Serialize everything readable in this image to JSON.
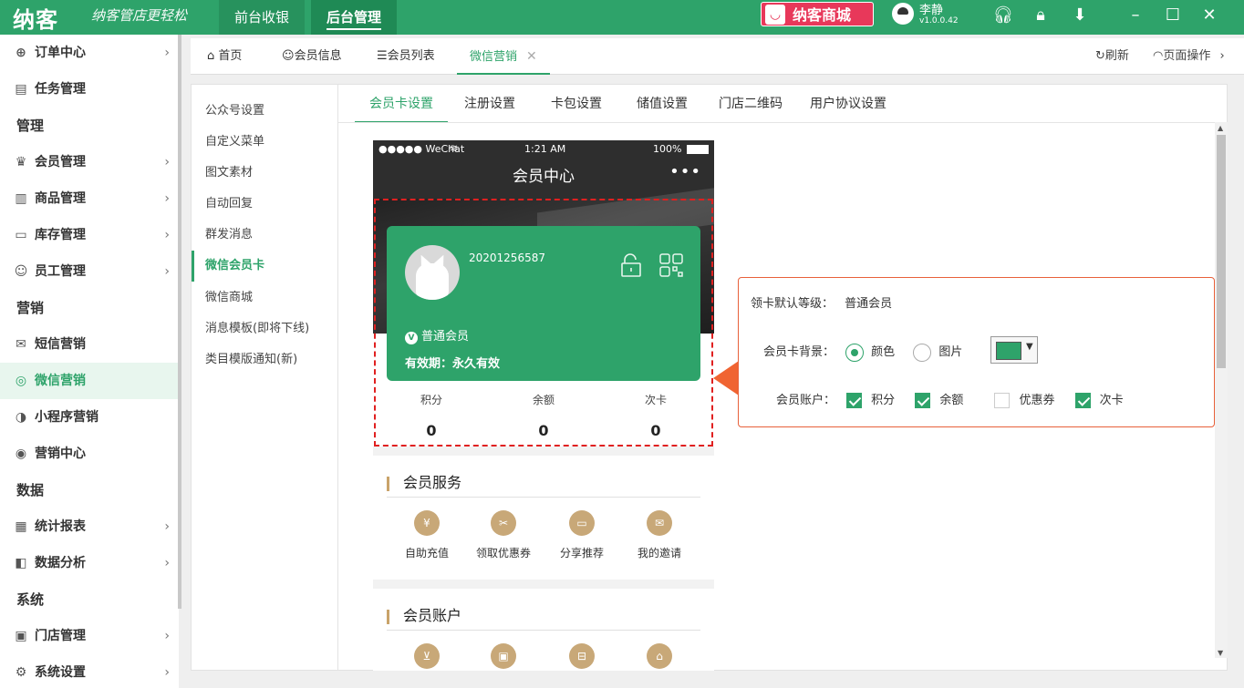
{
  "topbar": {
    "logo": "纳客",
    "slogan": "纳客管店更轻松",
    "tabs": [
      "前台收银",
      "后台管理"
    ],
    "shop": "纳客商城",
    "shop_icon": "bag-icon",
    "user": "李静",
    "version": "v1.0.0.42",
    "brand_color": "#2ea36a"
  },
  "sidebar": [
    {
      "type": "item",
      "label": "订单中心",
      "icon": "globe-icon",
      "arrow": true
    },
    {
      "type": "item",
      "label": "任务管理",
      "icon": "task-icon",
      "arrow": false
    },
    {
      "type": "cat",
      "label": "管理"
    },
    {
      "type": "item",
      "label": "会员管理",
      "icon": "crown-icon",
      "arrow": true
    },
    {
      "type": "item",
      "label": "商品管理",
      "icon": "goods-icon",
      "arrow": true
    },
    {
      "type": "item",
      "label": "库存管理",
      "icon": "box-icon",
      "arrow": true
    },
    {
      "type": "item",
      "label": "员工管理",
      "icon": "person-icon",
      "arrow": true
    },
    {
      "type": "cat",
      "label": "营销"
    },
    {
      "type": "item",
      "label": "短信营销",
      "icon": "mail-icon",
      "arrow": false
    },
    {
      "type": "item",
      "label": "微信营销",
      "icon": "wechat-icon",
      "arrow": false,
      "active": true
    },
    {
      "type": "item",
      "label": "小程序营销",
      "icon": "miniapp-icon",
      "arrow": false
    },
    {
      "type": "item",
      "label": "营销中心",
      "icon": "target-icon",
      "arrow": false
    },
    {
      "type": "cat",
      "label": "数据"
    },
    {
      "type": "item",
      "label": "统计报表",
      "icon": "barchart-icon",
      "arrow": true
    },
    {
      "type": "item",
      "label": "数据分析",
      "icon": "analysis-icon",
      "arrow": true
    },
    {
      "type": "cat",
      "label": "系统"
    },
    {
      "type": "item",
      "label": "门店管理",
      "icon": "store-icon",
      "arrow": true
    },
    {
      "type": "item",
      "label": "系统设置",
      "icon": "gear-icon",
      "arrow": true
    }
  ],
  "pagetabs": {
    "home": "首页",
    "member_info": "会员信息",
    "member_list": "会员列表",
    "wechat": "微信营销",
    "refresh": "刷新",
    "page_ops": "页面操作"
  },
  "submenu": [
    "公众号设置",
    "自定义菜单",
    "图文素材",
    "自动回复",
    "群发消息",
    "微信会员卡",
    "微信商城",
    "消息模板(即将下线)",
    "类目模版通知(新)"
  ],
  "submenu_active": 5,
  "content_tabs": [
    "会员卡设置",
    "注册设置",
    "卡包设置",
    "储值设置",
    "门店二维码",
    "用户协议设置"
  ],
  "phone": {
    "carrier": "●●●●● WeChat",
    "time": "1:21 AM",
    "battery": "100%",
    "title": "会员中心",
    "more": "•••",
    "card": {
      "number": "20201256587",
      "level": "普通会员",
      "valid": "有效期：永久有效",
      "badge": "V"
    },
    "stats": [
      {
        "label": "积分",
        "value": "0"
      },
      {
        "label": "余额",
        "value": "0"
      },
      {
        "label": "次卡",
        "value": "0"
      }
    ],
    "service_title": "会员服务",
    "services": [
      {
        "label": "自助充值",
        "icon": "moneybag-icon"
      },
      {
        "label": "领取优惠券",
        "icon": "coupon-icon"
      },
      {
        "label": "分享推荐",
        "icon": "card-icon"
      },
      {
        "label": "我的邀请",
        "icon": "invite-icon"
      }
    ],
    "account_title": "会员账户",
    "accounts": [
      {
        "icon": "cart-icon"
      },
      {
        "icon": "wallet-icon"
      },
      {
        "icon": "ticket-icon"
      },
      {
        "icon": "gift-icon"
      }
    ]
  },
  "panel": {
    "default_level_label": "领卡默认等级：",
    "default_level": "普通会员",
    "bg_label": "会员卡背景：",
    "bg_color": "颜色",
    "bg_image": "图片",
    "bg_selected": "color",
    "swatch": "#2ea36a",
    "account_label": "会员账户：",
    "accounts": [
      {
        "label": "积分",
        "checked": true
      },
      {
        "label": "余额",
        "checked": true
      },
      {
        "label": "优惠券",
        "checked": false
      },
      {
        "label": "次卡",
        "checked": true
      }
    ]
  }
}
